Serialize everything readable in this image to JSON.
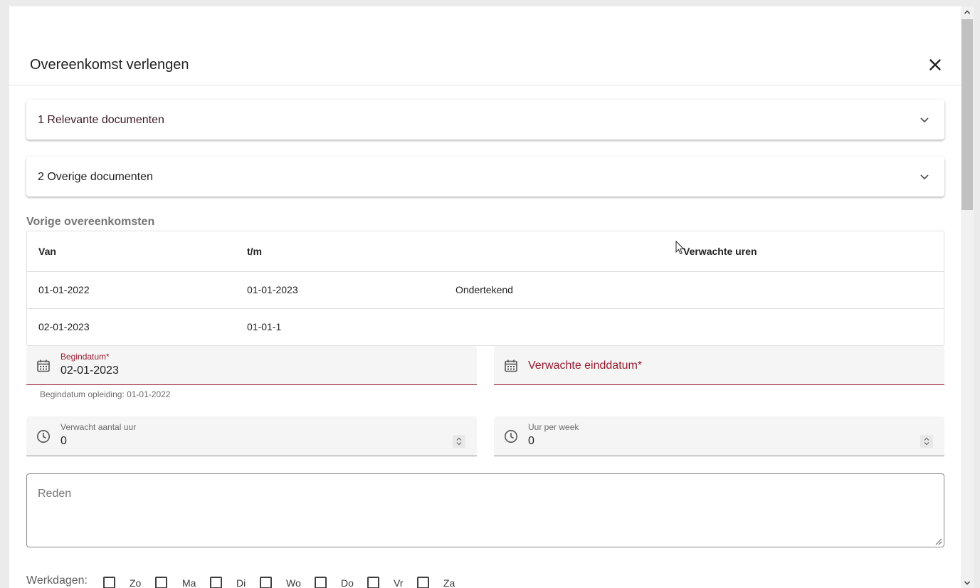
{
  "dialog": {
    "title": "Overeenkomst verlengen"
  },
  "panels": [
    {
      "title": "1 Relevante documenten"
    },
    {
      "title": "2 Overige documenten"
    }
  ],
  "previous": {
    "label": "Vorige overeenkomsten",
    "columns": [
      "Van",
      "t/m",
      "",
      "Verwachte uren"
    ],
    "rows": [
      [
        "01-01-2022",
        "01-01-2023",
        "Ondertekend",
        ""
      ],
      [
        "02-01-2023",
        "01-01-1",
        "",
        ""
      ]
    ]
  },
  "form": {
    "begindatum": {
      "label": "Begindatum*",
      "value": "02-01-2023",
      "hint": "Begindatum opleiding: 01-01-2022"
    },
    "einddatum": {
      "label": "Verwachte einddatum*"
    },
    "aantal_uur": {
      "label": "Verwacht aantal uur",
      "value": "0"
    },
    "uur_per_week": {
      "label": "Uur per week",
      "value": "0"
    },
    "reden": {
      "label": "Reden"
    }
  },
  "workdays": {
    "label": "Werkdagen:",
    "days": [
      "Zo",
      "Ma",
      "Di",
      "Wo",
      "Do",
      "Vr",
      "Za"
    ]
  },
  "colors": {
    "accent_invalid": "#9b1b30",
    "label_grey": "#757575"
  },
  "icons": {
    "close": "close-icon",
    "chevron": "chevron-down-icon",
    "calendar": "calendar-icon",
    "clock": "clock-icon"
  }
}
